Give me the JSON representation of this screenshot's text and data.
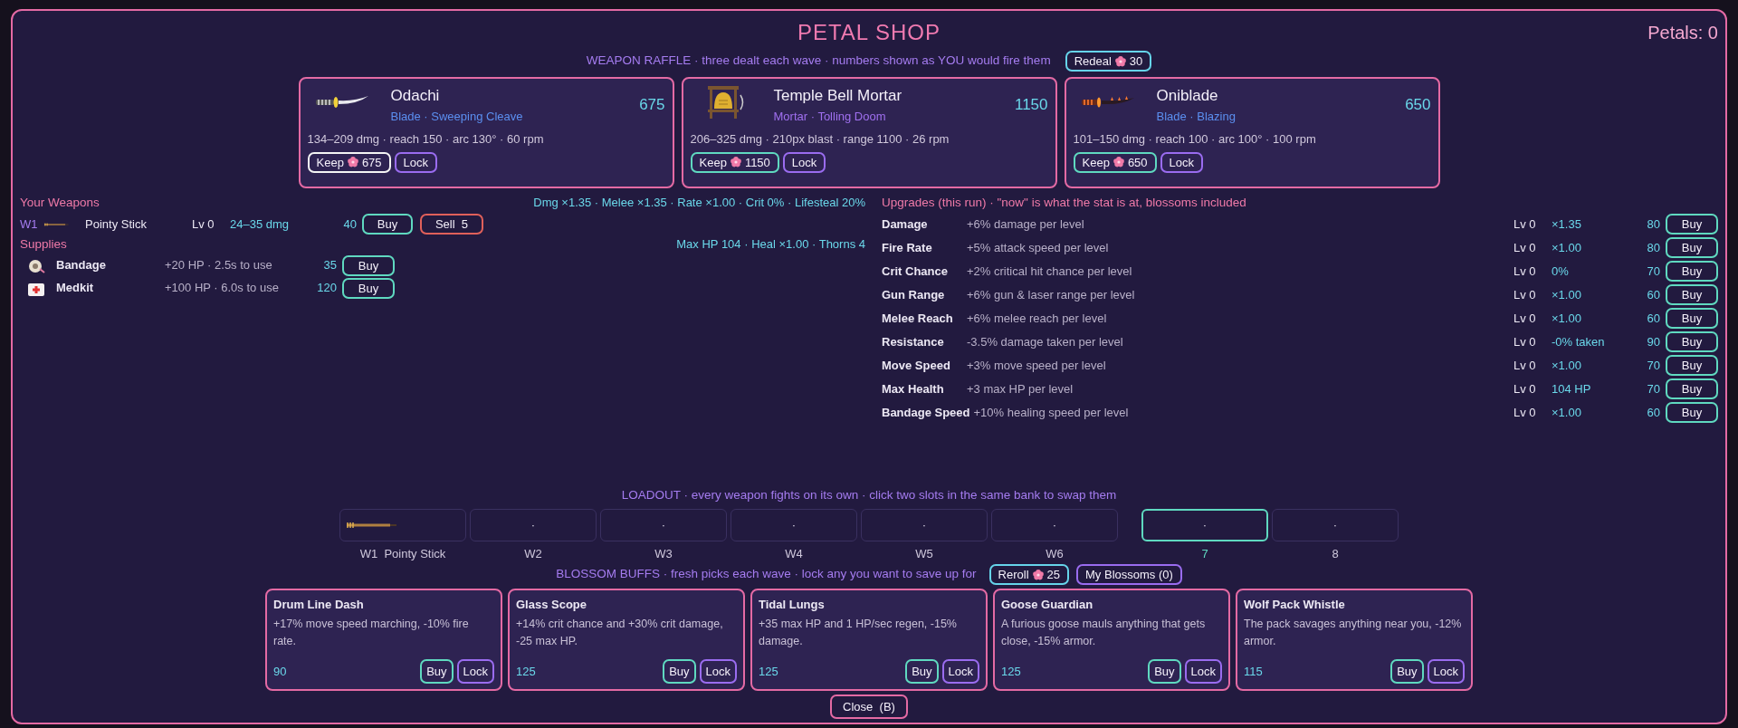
{
  "title": "PETAL SHOP",
  "petals": "Petals: 0",
  "raffle": {
    "text": "WEAPON RAFFLE  ·  three dealt each wave  ·  numbers shown as YOU would fire them",
    "redeal": {
      "label": "Redeal",
      "cost": "30"
    }
  },
  "offers": [
    {
      "kind": "katana",
      "name": "Odachi",
      "type": "Blade  ·  Sweeping Cleave",
      "color": "#5b8ff0",
      "price": "675",
      "stats": "134–209 dmg  ·  reach 150  ·  arc 130°  ·  60 rpm",
      "keep": {
        "label": "Keep",
        "cost": "675",
        "focused": true
      },
      "lock": "Lock"
    },
    {
      "kind": "bell",
      "name": "Temple Bell Mortar",
      "type": "Mortar  ·  Tolling Doom",
      "color": "#a070f0",
      "price": "1150",
      "stats": "206–325 dmg  ·  210px blast  ·  range 1100  ·  26 rpm",
      "keep": {
        "label": "Keep",
        "cost": "1150",
        "focused": false
      },
      "lock": "Lock"
    },
    {
      "kind": "flame_blade",
      "name": "Oniblade",
      "type": "Blade  ·  Blazing",
      "color": "#5b8ff0",
      "price": "650",
      "stats": "101–150 dmg  ·  reach 100  ·  arc 100°  ·  100 rpm",
      "keep": {
        "label": "Keep",
        "cost": "650",
        "focused": false
      },
      "lock": "Lock"
    }
  ],
  "weapons": {
    "title": "Your Weapons",
    "stats": "Dmg ×1.35  ·  Melee ×1.35  ·  Rate ×1.00  ·  Crit 0%  ·  Lifesteal 20%",
    "rows": [
      {
        "slot": "W1",
        "name": "Pointy Stick",
        "level": "Lv 0",
        "damage": "24–35 dmg",
        "price": "40",
        "buy": "Buy",
        "sell": "Sell  5"
      }
    ]
  },
  "supplies": {
    "title": "Supplies",
    "stats": "Max HP 104  ·  Heal ×1.00  ·  Thorns 4",
    "rows": [
      {
        "kind": "bandage",
        "name": "Bandage",
        "info": "+20 HP  ·  2.5s to use",
        "price": "35",
        "buy": "Buy"
      },
      {
        "kind": "medkit",
        "name": "Medkit",
        "info": "+100 HP  ·  6.0s to use",
        "price": "120",
        "buy": "Buy"
      }
    ]
  },
  "upgrades": {
    "title": "Upgrades (this run)  ·  \"now\" is what the stat is at, blossoms included",
    "rows": [
      {
        "name": "Damage",
        "desc": "+6% damage per level",
        "level": "Lv 0",
        "now": "×1.35",
        "price": "80",
        "buy": "Buy"
      },
      {
        "name": "Fire Rate",
        "desc": "+5% attack speed per level",
        "level": "Lv 0",
        "now": "×1.00",
        "price": "80",
        "buy": "Buy"
      },
      {
        "name": "Crit Chance",
        "desc": "+2% critical hit chance per level",
        "level": "Lv 0",
        "now": "0%",
        "price": "70",
        "buy": "Buy"
      },
      {
        "name": "Gun Range",
        "desc": "+6% gun & laser range per level",
        "level": "Lv 0",
        "now": "×1.00",
        "price": "60",
        "buy": "Buy"
      },
      {
        "name": "Melee Reach",
        "desc": "+6% melee reach per level",
        "level": "Lv 0",
        "now": "×1.00",
        "price": "60",
        "buy": "Buy"
      },
      {
        "name": "Resistance",
        "desc": "-3.5% damage taken per level",
        "level": "Lv 0",
        "now": "-0% taken",
        "price": "90",
        "buy": "Buy"
      },
      {
        "name": "Move Speed",
        "desc": "+3% move speed per level",
        "level": "Lv 0",
        "now": "×1.00",
        "price": "70",
        "buy": "Buy"
      },
      {
        "name": "Max Health",
        "desc": "+3 max HP per level",
        "level": "Lv 0",
        "now": "104 HP",
        "price": "70",
        "buy": "Buy"
      },
      {
        "name": "Bandage Speed",
        "desc": "+10% healing speed per level",
        "level": "Lv 0",
        "now": "×1.00",
        "price": "60",
        "buy": "Buy"
      }
    ]
  },
  "loadout": {
    "title": "LOADOUT  ·  every weapon fights on its own  ·  click two slots in the same bank to swap them",
    "banks": [
      {
        "slots": [
          {
            "kind": "stick",
            "label": "W1  Pointy Stick",
            "selected": false
          },
          {
            "kind": "empty",
            "content": "·",
            "label": "W2",
            "selected": false
          },
          {
            "kind": "empty",
            "content": "·",
            "label": "W3",
            "selected": false
          },
          {
            "kind": "empty",
            "content": "·",
            "label": "W4",
            "selected": false
          },
          {
            "kind": "empty",
            "content": "·",
            "label": "W5",
            "selected": false
          },
          {
            "kind": "empty",
            "content": "·",
            "label": "W6",
            "selected": false
          }
        ]
      },
      {
        "slots": [
          {
            "kind": "empty",
            "content": "·",
            "label": "7",
            "selected": true
          },
          {
            "kind": "empty",
            "content": "·",
            "label": "8",
            "selected": false
          }
        ]
      }
    ]
  },
  "blossoms": {
    "title": "BLOSSOM BUFFS  ·  fresh picks each wave  ·  lock any you want to save up for",
    "reroll": {
      "label": "Reroll",
      "cost": "25"
    },
    "mine": "My Blossoms (0)",
    "cards": [
      {
        "name": "Drum Line Dash",
        "desc": "+17% move speed marching, -10% fire rate.",
        "price": "90",
        "buy": "Buy",
        "lock": "Lock"
      },
      {
        "name": "Glass Scope",
        "desc": "+14% crit chance and +30% crit damage, -25 max HP.",
        "price": "125",
        "buy": "Buy",
        "lock": "Lock"
      },
      {
        "name": "Tidal Lungs",
        "desc": "+35 max HP and 1 HP/sec regen, -15% damage.",
        "price": "125",
        "buy": "Buy",
        "lock": "Lock"
      },
      {
        "name": "Goose Guardian",
        "desc": "A furious goose mauls anything that gets close, -15% armor.",
        "price": "125",
        "buy": "Buy",
        "lock": "Lock"
      },
      {
        "name": "Wolf Pack Whistle",
        "desc": "The pack savages anything near you, -12% armor.",
        "price": "115",
        "buy": "Buy",
        "lock": "Lock"
      }
    ]
  },
  "close": "Close  (B)"
}
